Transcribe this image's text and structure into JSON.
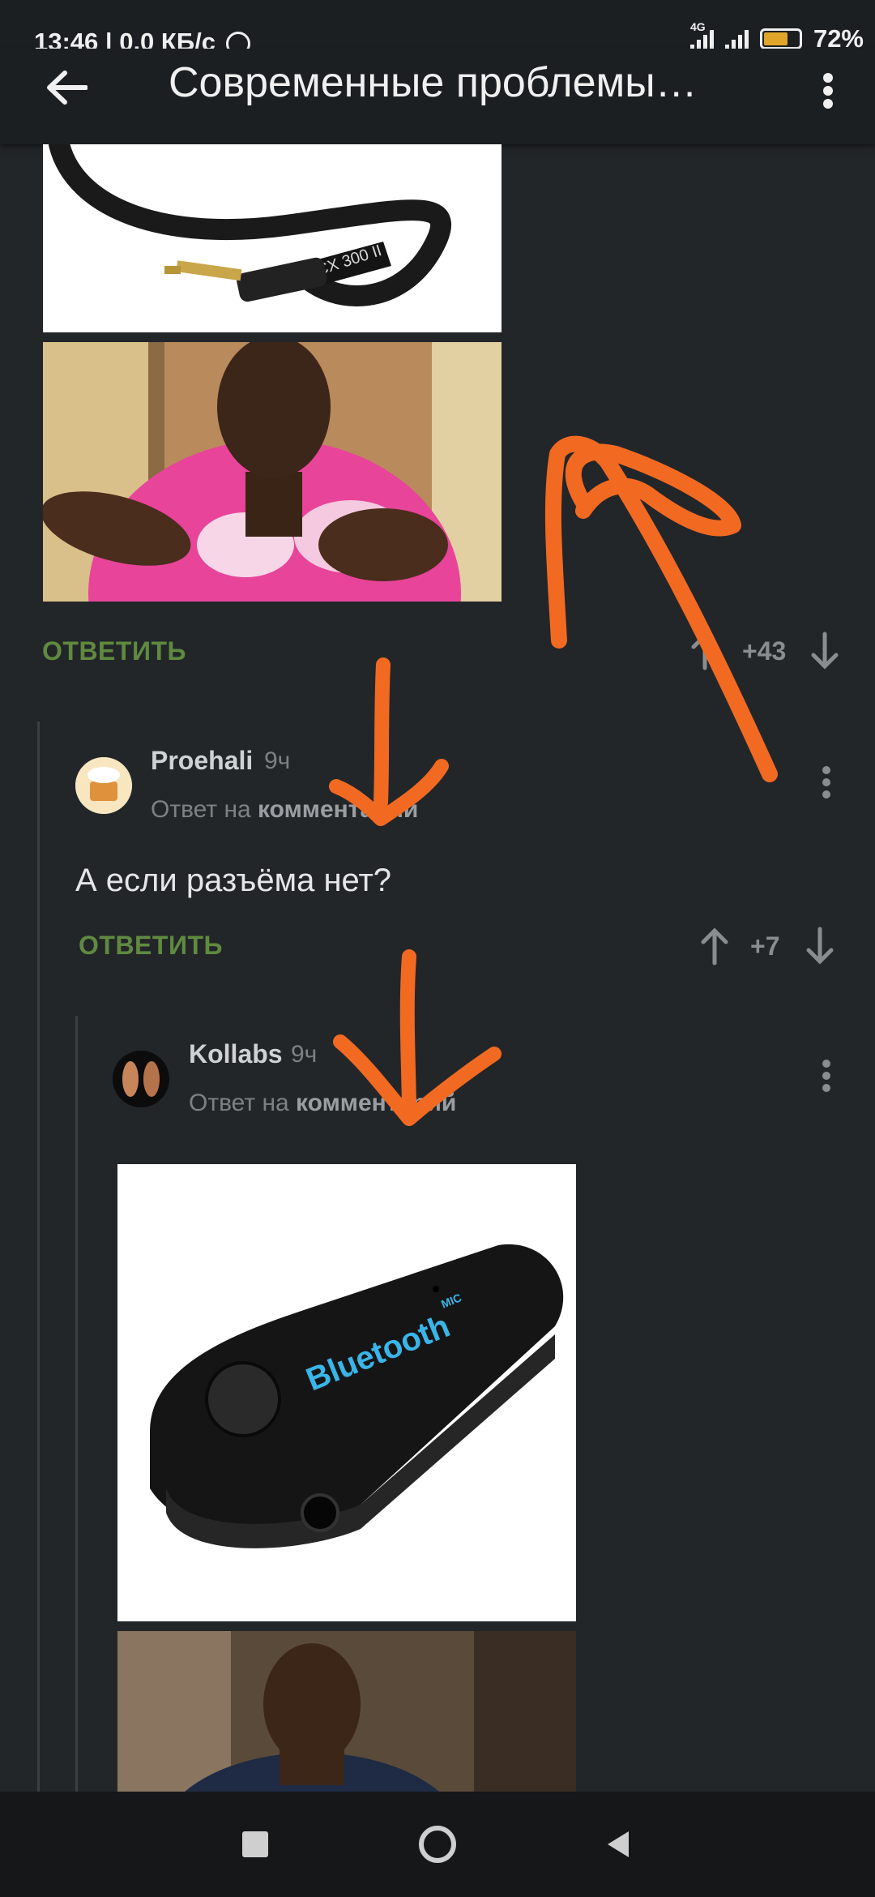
{
  "status": {
    "time": "13:46",
    "speed": "0,0 КБ/с",
    "network": "4G",
    "battery": "72%"
  },
  "header": {
    "title": "Современные проблемы…"
  },
  "thread": {
    "reply_label": "ОТВЕТИТЬ",
    "parent": {
      "score": "+43"
    },
    "comment1": {
      "user": "Proehali",
      "time": "9ч",
      "reply_prefix": "Ответ на",
      "reply_target": "комментарий",
      "text": "А если разъёма нет?",
      "score": "+7"
    },
    "comment2": {
      "user": "Kollabs",
      "time": "9ч",
      "reply_prefix": "Ответ на",
      "reply_target": "комментарий",
      "image_text": "Bluetooth",
      "image_subtext": "MIC"
    },
    "cable_text": "CX 300 II"
  },
  "colors": {
    "accent_green": "#5f8a3f",
    "annotation_orange": "#f26a21"
  }
}
